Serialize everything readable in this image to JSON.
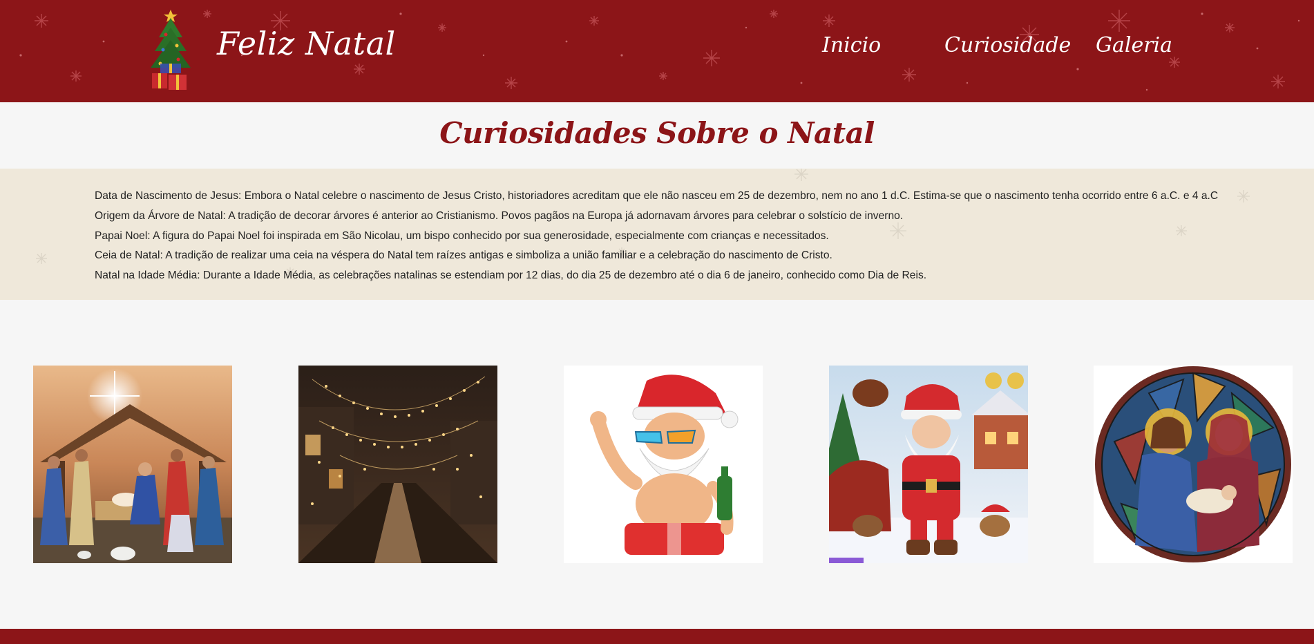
{
  "header": {
    "brand": "Feliz Natal",
    "logo_icon": "christmas-tree-icon",
    "background_color": "#8c1518",
    "nav": [
      {
        "label": "Inicio"
      },
      {
        "label": "Curiosidade"
      },
      {
        "label": "Galeria"
      }
    ]
  },
  "main": {
    "title": "Curiosidades Sobre o Natal",
    "facts": [
      "Data de Nascimento de Jesus: Embora o Natal celebre o nascimento de Jesus Cristo, historiadores acreditam que ele não nasceu em 25 de dezembro, nem no ano 1 d.C. Estima-se que o nascimento tenha ocorrido entre 6 a.C. e 4 a.C",
      "Origem da Árvore de Natal: A tradição de decorar árvores é anterior ao Cristianismo. Povos pagãos na Europa já adornavam árvores para celebrar o solstício de inverno.",
      "Papai Noel: A figura do Papai Noel foi inspirada em São Nicolau, um bispo conhecido por sua generosidade, especialmente com crianças e necessitados.",
      "Ceia de Natal: A tradição de realizar uma ceia na véspera do Natal tem raízes antigas e simboliza a união familiar e a celebração do nascimento de Cristo.",
      "Natal na Idade Média: Durante a Idade Média, as celebrações natalinas se estendiam por 12 dias, do dia 25 de dezembro até o dia 6 de janeiro, conhecido como Dia de Reis."
    ],
    "facts_background_color": "#efe8da"
  },
  "gallery": {
    "images": [
      {
        "icon": "nativity-scene-image"
      },
      {
        "icon": "lit-street-image"
      },
      {
        "icon": "beach-santa-image"
      },
      {
        "icon": "santa-sleigh-image"
      },
      {
        "icon": "stained-glass-holy-family-image"
      }
    ]
  },
  "colors": {
    "accent": "#8c1518",
    "page_background": "#f6f6f6"
  }
}
